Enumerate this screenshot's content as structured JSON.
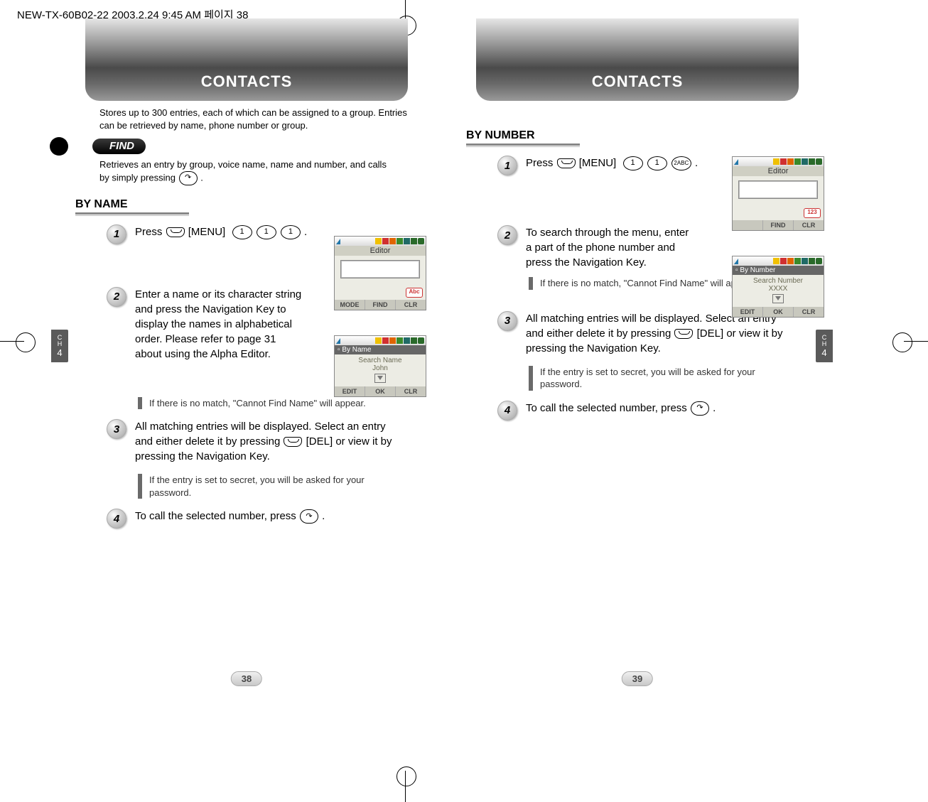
{
  "printer_header": "NEW-TX-60B02-22 2003.2.24 9:45 AM  페이지 38",
  "left": {
    "header_title": "CONTACTS",
    "intro": "Stores up to 300 entries, each of which can be assigned to a group. Entries can be retrieved by name, phone number or group.",
    "find_label": "FIND",
    "find_desc_a": "Retrieves an entry by group, voice name, name and number, and calls by simply pressing",
    "find_desc_b": ".",
    "section": "BY NAME",
    "steps": {
      "s1_a": "Press",
      "s1_b": "[MENU]",
      "s1_c": ".",
      "s2": "Enter a name or its character string and press the Navigation Key to display the names in alphabetical order. Please refer to page 31 about using the Alpha Editor.",
      "note1": "If there is no match, \"Cannot Find Name\" will appear.",
      "s3_a": "All matching entries will be displayed. Select an entry and either delete it by pressing",
      "s3_b": "[DEL] or view it by pressing the Navigation Key.",
      "note2": "If the entry is set to secret, you will be asked for your password.",
      "s4_a": "To call the selected number, press",
      "s4_b": "."
    },
    "phone1": {
      "title": "Editor",
      "mode": "Abc",
      "sk1": "MODE",
      "sk2": "FIND",
      "sk3": "CLR"
    },
    "phone2": {
      "hdr": "By Name",
      "line1": "Search Name",
      "line2": "John",
      "sk1": "EDIT",
      "sk2": "OK",
      "sk3": "CLR"
    },
    "pagenum": "38",
    "ch": {
      "a": "C",
      "b": "H",
      "c": "4"
    }
  },
  "right": {
    "header_title": "CONTACTS",
    "section": "BY NUMBER",
    "steps": {
      "s1_a": "Press",
      "s1_b": "[MENU]",
      "s1_c": ".",
      "key3": "2ABC",
      "s2": "To search through the menu, enter a part of the phone number and press the Navigation Key.",
      "note1": "If there is no match, \"Cannot Find Name\" will appear.",
      "s3_a": "All matching entries will be displayed. Select an entry and either delete it by pressing",
      "s3_b": "[DEL] or view it by pressing the Navigation Key.",
      "note2": "If the entry is set to secret, you will be asked for your password.",
      "s4_a": "To call the selected number, press",
      "s4_b": "."
    },
    "phone1": {
      "title": "Editor",
      "mode": "123",
      "sk1": "",
      "sk2": "FIND",
      "sk3": "CLR"
    },
    "phone2": {
      "hdr": "By Number",
      "line1": "Search Number",
      "line2": "XXXX",
      "sk1": "EDIT",
      "sk2": "OK",
      "sk3": "CLR"
    },
    "pagenum": "39",
    "ch": {
      "a": "C",
      "b": "H",
      "c": "4"
    }
  },
  "keys": {
    "one": "1",
    "oneb": "1",
    "onec": "1",
    "two": "2ABC"
  }
}
